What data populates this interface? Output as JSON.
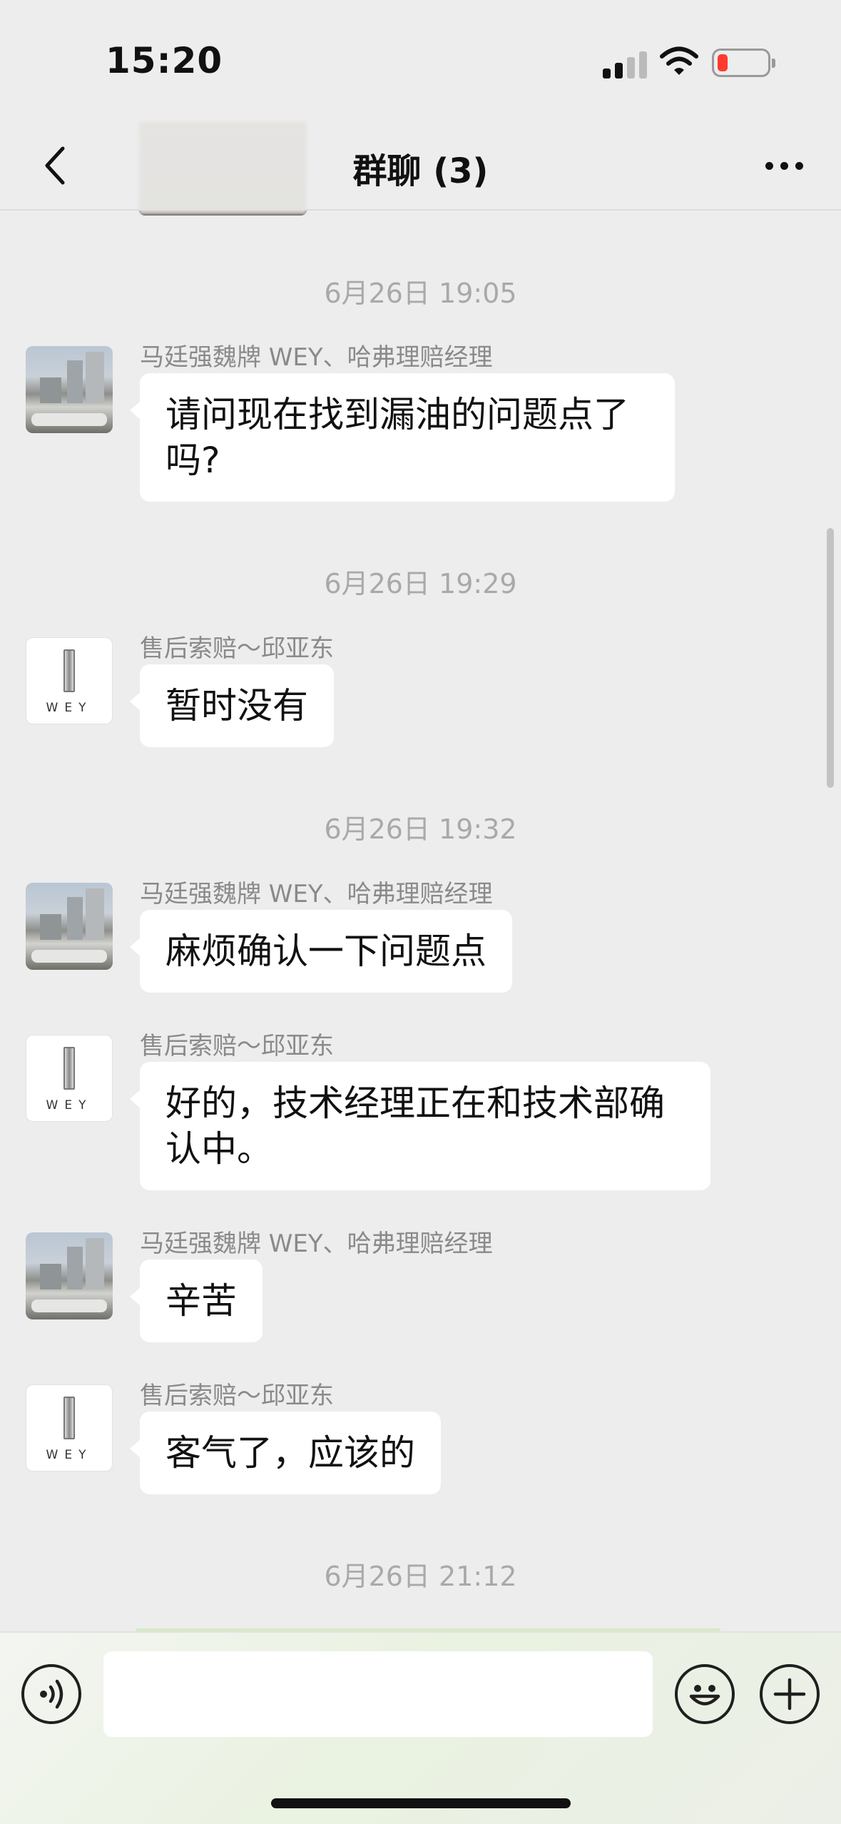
{
  "status_bar": {
    "time": "15:20",
    "signal_icon": "cellular-signal-icon",
    "wifi_icon": "wifi-icon",
    "battery_icon": "battery-low-icon",
    "battery_color": "#ff3b30"
  },
  "nav": {
    "title": "群聊 (3)",
    "back_icon": "chevron-left-icon",
    "more_icon": "more-dots-icon"
  },
  "messages": [
    {
      "type": "time",
      "text": "6月26日 19:05"
    },
    {
      "type": "message",
      "avatar": "photo",
      "sender": "马廷强魏牌 WEY、哈弗理赔经理",
      "lines": [
        "请问现在找到漏油的问题点了",
        "吗?"
      ]
    },
    {
      "type": "time",
      "text": "6月26日 19:29"
    },
    {
      "type": "message",
      "avatar": "wey",
      "sender": "售后索赔～邱亚东",
      "lines": [
        "暂时没有"
      ]
    },
    {
      "type": "time",
      "text": "6月26日 19:32"
    },
    {
      "type": "message",
      "avatar": "photo",
      "sender": "马廷强魏牌 WEY、哈弗理赔经理",
      "lines": [
        "麻烦确认一下问题点"
      ]
    },
    {
      "type": "message",
      "avatar": "wey",
      "sender": "售后索赔～邱亚东",
      "lines": [
        "好的，技术经理正在和技术部确",
        "认中。"
      ]
    },
    {
      "type": "message",
      "avatar": "photo",
      "sender": "马廷强魏牌 WEY、哈弗理赔经理",
      "lines": [
        "辛苦"
      ]
    },
    {
      "type": "message",
      "avatar": "wey",
      "sender": "售后索赔～邱亚东",
      "lines": [
        "客气了，应该的"
      ]
    },
    {
      "type": "time",
      "text": "6月26日 21:12"
    }
  ],
  "wey_logo_text": "WEY",
  "input": {
    "value": "",
    "voice_icon": "voice-input-icon",
    "emoji_icon": "emoji-icon",
    "plus_icon": "plus-circle-icon"
  }
}
